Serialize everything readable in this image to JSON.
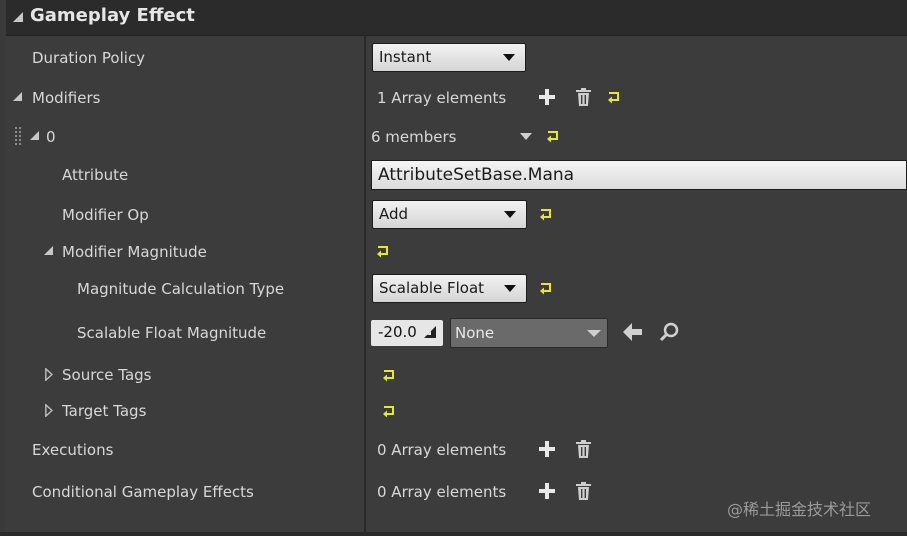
{
  "section": {
    "title": "Gameplay Effect"
  },
  "rows": {
    "duration_policy": {
      "label": "Duration Policy",
      "value": "Instant"
    },
    "modifiers": {
      "label": "Modifiers",
      "value": "1 Array elements"
    },
    "modifier_0": {
      "label": "0",
      "value": "6 members"
    },
    "attribute": {
      "label": "Attribute",
      "value": "AttributeSetBase.Mana"
    },
    "modifier_op": {
      "label": "Modifier Op",
      "value": "Add"
    },
    "modifier_magnitude": {
      "label": "Modifier Magnitude"
    },
    "calc_type": {
      "label": "Magnitude Calculation Type",
      "value": "Scalable Float"
    },
    "scalable_float": {
      "label": "Scalable Float Magnitude",
      "value": "-20.0",
      "curve": "None"
    },
    "source_tags": {
      "label": "Source Tags"
    },
    "target_tags": {
      "label": "Target Tags"
    },
    "executions": {
      "label": "Executions",
      "value": "0 Array elements"
    },
    "conditional": {
      "label": "Conditional Gameplay Effects",
      "value": "0 Array elements"
    }
  },
  "watermark": "@稀土掘金技术社区",
  "colors": {
    "reset_arrow": "#e6e636",
    "combo_light": "#e4e4e4",
    "panel": "#3c3c3c"
  },
  "icons": [
    "triangle-down-icon",
    "triangle-right-icon",
    "plus-icon",
    "trash-icon",
    "reset-arrow-icon",
    "drag-handle-icon",
    "chevron-down-icon",
    "arrow-left-icon",
    "search-icon"
  ]
}
